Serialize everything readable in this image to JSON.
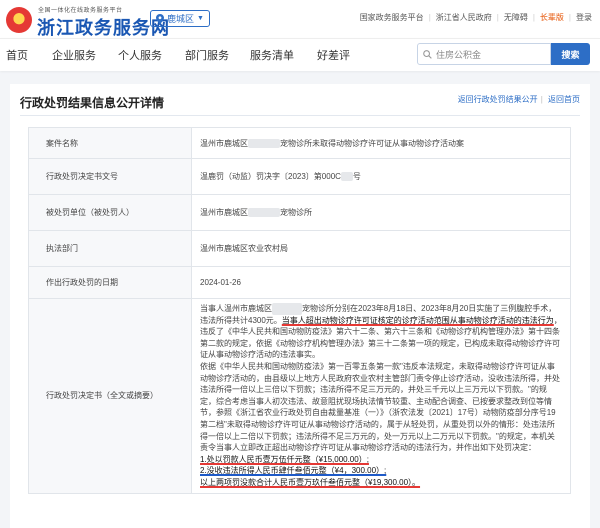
{
  "header": {
    "logo_small": "全国一体化在线政务服务平台",
    "logo_big": "浙江政务服务网",
    "region": "鹿城区",
    "links": [
      "国家政务服务平台",
      "浙江省人民政府",
      "无障碍",
      "长辈版",
      "登录"
    ]
  },
  "nav": {
    "items": [
      "首页",
      "企业服务",
      "个人服务",
      "部门服务",
      "服务清单",
      "好差评"
    ],
    "search_placeholder": "住房公积金",
    "search_button": "搜索"
  },
  "page": {
    "title": "行政处罚结果信息公开详情",
    "back_links": [
      "返回行政处罚结果公开",
      "返回首页"
    ]
  },
  "details": {
    "labels": {
      "case_name": "案件名称",
      "doc_no": "行政处罚决定书文号",
      "party": "被处罚单位（被处罚人）",
      "agency": "执法部门",
      "date": "作出行政处罚的日期",
      "content": "行政处罚决定书（全文或摘要）"
    },
    "case_name_pre": "温州市鹿城区",
    "case_name_post": "宠物诊所未取得动物诊疗许可证从事动物诊疗活动案",
    "doc_no_pre": "温鹿罚（动监）罚决字〔2023〕第000C",
    "doc_no_post": "号",
    "party_pre": "温州市鹿城区",
    "party_post": "宠物诊所",
    "agency": "温州市鹿城区农业农村局",
    "date": "2024-01-26",
    "p1a": "当事人温州市鹿城区",
    "p1b": "宠物诊所分别在2023年8月18日、2023年8月20日实施了三例腹腔手术，违法所得共计4300元。",
    "p1c": "当事人超出动物诊疗许可证核定的诊疗活动范围从事动物诊疗活动的违法行为",
    "p1d": "，违反了《中华人民共和国动物防疫法》第六十二条、第六十三条和《动物诊疗机构管理办法》第十四条第二款的规定，依据《动物诊疗机构管理办法》第三十二条第一项的规定，已构成未取得动物诊疗许可证从事动物诊疗活动的违法事实。",
    "p2": "依据《中华人民共和国动物防疫法》第一百零五条第一款\"违反本法规定，未取得动物诊疗许可证从事动物诊疗活动的，由县级以上地方人民政府农业农村主管部门责令停止诊疗活动，没收违法所得，并处违法所得一倍以上三倍以下罚款；违法所得不足三万元的，并处三千元以上三万元以下罚款。\"的规定，综合考虑当事人初次违法、故意阻扰现场执法情节较重、主动配合调查、已按要求整改到位等情节，参照《浙江省农业行政处罚自由裁量基准（一）》（浙农法发〔2021〕17号）动物防疫部分序号19第二档\"未取得动物诊疗许可证从事动物诊疗活动的，属于从轻处罚，从重处罚以外的情形：处违法所得一倍以上二倍以下罚款；违法所得不足三万元的，处一万元以上二万元以下罚款。\"的规定，本机关责令当事人立即改正超出动物诊疗许可证从事动物诊疗活动的违法行为，并作出如下处罚决定：",
    "p3": "1.处以罚款人民币壹万伍仟元整（¥15,000.00）;",
    "p4": "2.没收违法所得人民币肆仟叁佰元整（¥4，300.00）;",
    "p5": "以上两项罚没款合计人民币壹万玖仟叁佰元整（¥19,300.00）。"
  },
  "colors": {
    "brand_blue": "#1a57b3",
    "accent_blue": "#2d6ec6",
    "underline_red": "#e53935",
    "underline_blue": "#1e5ac8"
  }
}
